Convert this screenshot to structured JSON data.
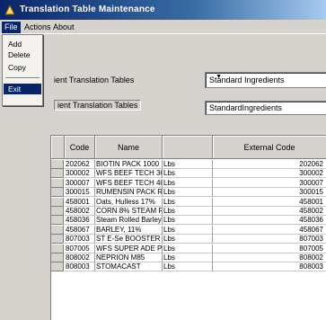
{
  "window": {
    "title": "Translation Table Maintenance"
  },
  "menubar": {
    "file": "File",
    "actions": "Actions",
    "about": "About"
  },
  "file_menu": {
    "add": "Add",
    "delete": "Delete",
    "copy": "Copy",
    "exit": "Exit"
  },
  "form": {
    "translation_tables_label": "ient Translation Tables",
    "dest_tables_label": "ient Translation Tables",
    "translation_tables_value": "Standard Ingredients",
    "dest_tables_value": "StandardIngredients"
  },
  "grid": {
    "headers": {
      "code": "Code",
      "name": "Name",
      "unit": "",
      "ext": "External Code"
    },
    "rows": [
      {
        "code": "202062",
        "name": "BIOTIN PACK 1000",
        "unit": "Lbs",
        "ext": "202062"
      },
      {
        "code": "300002",
        "name": "WFS BEEF TECH 36-",
        "unit": "Lbs",
        "ext": "300002"
      },
      {
        "code": "300007",
        "name": "WFS BEEF TECH 40-",
        "unit": "Lbs",
        "ext": "300007"
      },
      {
        "code": "300015",
        "name": "RUMENSIN PACK R-1",
        "unit": "Lbs",
        "ext": "300015"
      },
      {
        "code": "458001",
        "name": "Oats, Hulless 17%",
        "unit": "Lbs",
        "ext": "458001"
      },
      {
        "code": "458002",
        "name": "CORN 8% STEAM RO",
        "unit": "Lbs",
        "ext": "458002"
      },
      {
        "code": "458036",
        "name": "Steam Rolled Barley",
        "unit": "Lbs",
        "ext": "458036"
      },
      {
        "code": "458067",
        "name": "BARLEY, 11%",
        "unit": "Lbs",
        "ext": "458067"
      },
      {
        "code": "807003",
        "name": "ST E-Se BOOSTER",
        "unit": "Lbs",
        "ext": "807003"
      },
      {
        "code": "807005",
        "name": "WFS SUPER ADE PM",
        "unit": "Lbs",
        "ext": "807005"
      },
      {
        "code": "808002",
        "name": "NEPRION M85",
        "unit": "Lbs",
        "ext": "808002"
      },
      {
        "code": "808003",
        "name": "STOMACAST",
        "unit": "Lbs",
        "ext": "808003"
      }
    ]
  }
}
